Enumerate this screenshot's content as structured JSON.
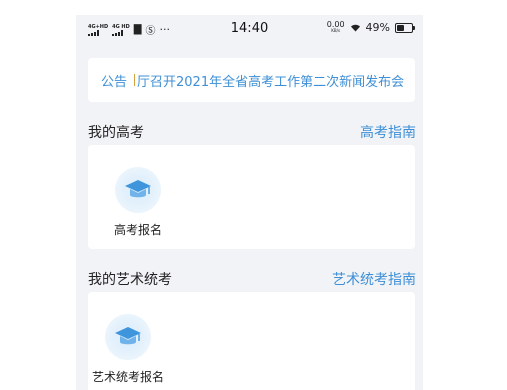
{
  "status_bar": {
    "network_1": "4G+HD",
    "network_2": "4G HD",
    "time": "14:40",
    "speed_value": "0.00",
    "speed_unit": "KB/s",
    "battery": "49%"
  },
  "notice": {
    "label": "公告",
    "text": "厅召开2021年全省高考工作第二次新闻发布会"
  },
  "gaokao": {
    "title": "我的高考",
    "link": "高考指南",
    "tiles": [
      {
        "label": "高考报名",
        "icon": "graduation-cap-icon"
      }
    ]
  },
  "art": {
    "title": "我的艺术统考",
    "link": "艺术统考指南",
    "tiles": [
      {
        "label": "艺术统考报名",
        "icon": "graduation-cap-icon"
      }
    ]
  },
  "colors": {
    "accent": "#3f8fd6",
    "background": "#f2f3f7",
    "card": "#ffffff"
  }
}
